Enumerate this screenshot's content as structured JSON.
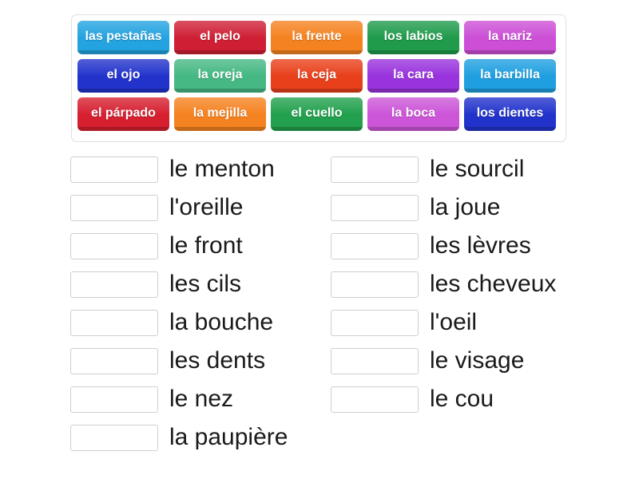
{
  "tile_bank": {
    "name": "word-tile-bank",
    "rows": [
      [
        {
          "label": "las pestañas",
          "color": "#23a3e0"
        },
        {
          "label": "el pelo",
          "color": "#cf1f35"
        },
        {
          "label": "la frente",
          "color": "#f58220"
        },
        {
          "label": "los labios",
          "color": "#1f9b4b"
        },
        {
          "label": "la nariz",
          "color": "#cc4fd6"
        }
      ],
      [
        {
          "label": "el ojo",
          "color": "#2233cc"
        },
        {
          "label": "la oreja",
          "color": "#45b883"
        },
        {
          "label": "la ceja",
          "color": "#e8401a"
        },
        {
          "label": "la cara",
          "color": "#9933dd"
        },
        {
          "label": "la barbilla",
          "color": "#1f9fe0"
        }
      ],
      [
        {
          "label": "el párpado",
          "color": "#d62030"
        },
        {
          "label": "la mejilla",
          "color": "#f58220"
        },
        {
          "label": "el cuello",
          "color": "#22a04d"
        },
        {
          "label": "la boca",
          "color": "#cc55d8"
        },
        {
          "label": "los dientes",
          "color": "#2233cc"
        }
      ]
    ]
  },
  "answers": {
    "placeholder": "",
    "left_column": [
      {
        "answer_value": "",
        "prompt": "le menton"
      },
      {
        "answer_value": "",
        "prompt": "l'oreille"
      },
      {
        "answer_value": "",
        "prompt": "le front"
      },
      {
        "answer_value": "",
        "prompt": "les cils"
      },
      {
        "answer_value": "",
        "prompt": "la bouche"
      },
      {
        "answer_value": "",
        "prompt": "les dents"
      },
      {
        "answer_value": "",
        "prompt": "le nez"
      },
      {
        "answer_value": "",
        "prompt": "la paupière"
      }
    ],
    "right_column": [
      {
        "answer_value": "",
        "prompt": "le sourcil"
      },
      {
        "answer_value": "",
        "prompt": "la joue"
      },
      {
        "answer_value": "",
        "prompt": "les lèvres"
      },
      {
        "answer_value": "",
        "prompt": "les cheveux"
      },
      {
        "answer_value": "",
        "prompt": "l'oeil"
      },
      {
        "answer_value": "",
        "prompt": "le visage"
      },
      {
        "answer_value": "",
        "prompt": "le cou"
      }
    ]
  },
  "colors": {
    "page_background": "#ffffff",
    "bank_border": "#e0e0e0",
    "box_border": "#cfcfcf",
    "text": "#1a1a1a",
    "tile_text": "#ffffff"
  }
}
